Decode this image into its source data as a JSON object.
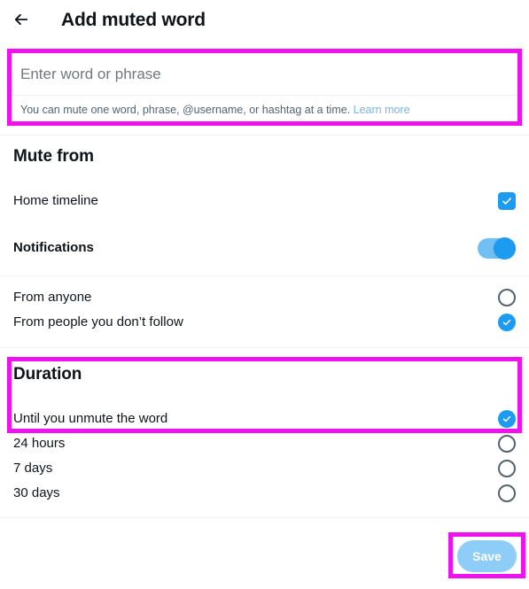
{
  "header": {
    "back_icon": "arrow-left-icon",
    "title": "Add muted word"
  },
  "word_input": {
    "value": "",
    "placeholder": "Enter word or phrase",
    "help_text": "You can mute one word, phrase, @username, or hashtag at a time.",
    "help_link": "Learn more"
  },
  "mute_from": {
    "title": "Mute from",
    "options": [
      {
        "label": "Home timeline",
        "control": "checkbox",
        "checked": true
      },
      {
        "label": "Notifications",
        "control": "toggle",
        "checked": true
      },
      {
        "label": "From anyone",
        "control": "radio",
        "checked": false
      },
      {
        "label": "From people you don’t follow",
        "control": "radio",
        "checked": true
      }
    ]
  },
  "duration": {
    "title": "Duration",
    "options": [
      {
        "label": "Until you unmute the word",
        "control": "radio",
        "checked": true
      },
      {
        "label": "24 hours",
        "control": "radio",
        "checked": false
      },
      {
        "label": "7 days",
        "control": "radio",
        "checked": false
      },
      {
        "label": "30 days",
        "control": "radio",
        "checked": false
      }
    ]
  },
  "footer": {
    "save_label": "Save"
  },
  "colors": {
    "accent": "#1d9bf0",
    "accent_disabled": "#8ecdf8",
    "toggle_track": "#70c0f4",
    "link": "#7eb4e2",
    "text_primary": "#0f1419",
    "text_secondary": "#536471",
    "divider": "#eff3f4",
    "highlight": "#ef12ef"
  }
}
